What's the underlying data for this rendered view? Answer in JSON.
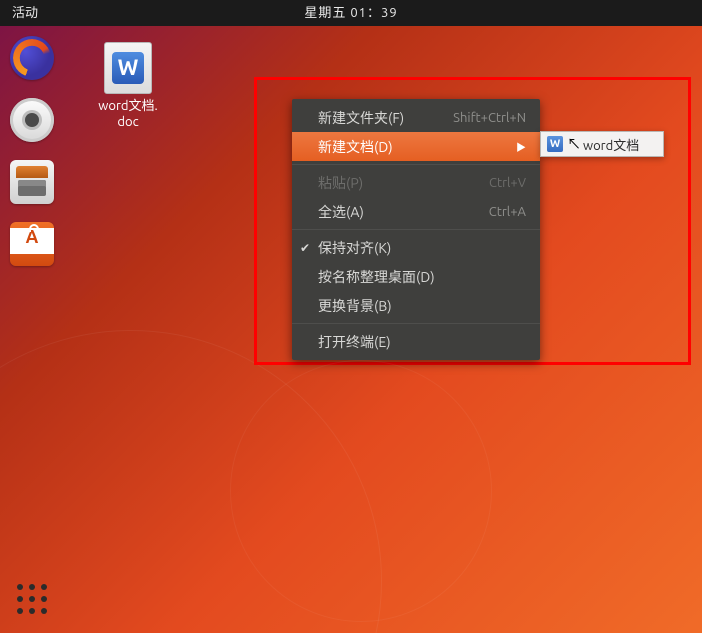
{
  "topbar": {
    "activities": "活动",
    "clock": "星期五 01：39"
  },
  "dock": {
    "items": [
      {
        "name": "firefox"
      },
      {
        "name": "rhythmbox"
      },
      {
        "name": "files"
      },
      {
        "name": "software"
      }
    ]
  },
  "desktop": {
    "file_label": "word文档.\ndoc"
  },
  "context_menu": {
    "items": [
      {
        "label": "新建文件夹(F)",
        "accel": "Shift+Ctrl+N",
        "enabled": true
      },
      {
        "label": "新建文档(D)",
        "accel": "",
        "enabled": true,
        "highlight": true,
        "submenu": true
      },
      {
        "label": "粘贴(P)",
        "accel": "Ctrl+V",
        "enabled": false,
        "sep_before": true
      },
      {
        "label": "全选(A)",
        "accel": "Ctrl+A",
        "enabled": true
      },
      {
        "label": "保持对齐(K)",
        "accel": "",
        "enabled": true,
        "checked": true,
        "sep_before": true
      },
      {
        "label": "按名称整理桌面(D)",
        "accel": "",
        "enabled": true
      },
      {
        "label": "更换背景(B)",
        "accel": "",
        "enabled": true
      },
      {
        "label": "打开终端(E)",
        "accel": "",
        "enabled": true,
        "sep_before": true
      }
    ]
  },
  "submenu": {
    "label": "word文档"
  }
}
